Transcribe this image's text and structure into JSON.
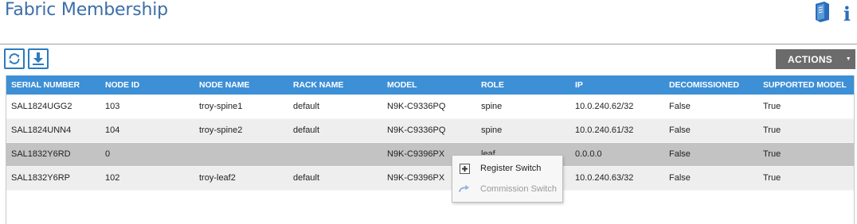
{
  "header": {
    "title": "Fabric Membership",
    "info_icon": "i"
  },
  "toolbar": {
    "refresh_icon": "refresh-icon",
    "download_icon": "download-icon",
    "actions_label": "ACTIONS",
    "actions_caret": "▼"
  },
  "table": {
    "columns": [
      "SERIAL NUMBER",
      "NODE ID",
      "NODE NAME",
      "RACK NAME",
      "MODEL",
      "ROLE",
      "IP",
      "DECOMISSIONED",
      "SUPPORTED MODEL"
    ],
    "rows": [
      [
        "SAL1824UGG2",
        "103",
        "troy-spine1",
        "default",
        "N9K-C9336PQ",
        "spine",
        "10.0.240.62/32",
        "False",
        "True"
      ],
      [
        "SAL1824UNN4",
        "104",
        "troy-spine2",
        "default",
        "N9K-C9336PQ",
        "spine",
        "10.0.240.61/32",
        "False",
        "True"
      ],
      [
        "SAL1832Y6RD",
        "0",
        "",
        "",
        "N9K-C9396PX",
        "leaf",
        "0.0.0.0",
        "False",
        "True"
      ],
      [
        "SAL1832Y6RP",
        "102",
        "troy-leaf2",
        "default",
        "N9K-C9396PX",
        "leaf",
        "10.0.240.63/32",
        "False",
        "True"
      ]
    ]
  },
  "context_menu": {
    "register_label": "Register Switch",
    "commission_label": "Commission Switch"
  },
  "colors": {
    "title": "#3c6ea8",
    "header_bg": "#3d8fd6",
    "selected_row": "#c3c3c3",
    "actions_bg": "#6b6b6b"
  }
}
